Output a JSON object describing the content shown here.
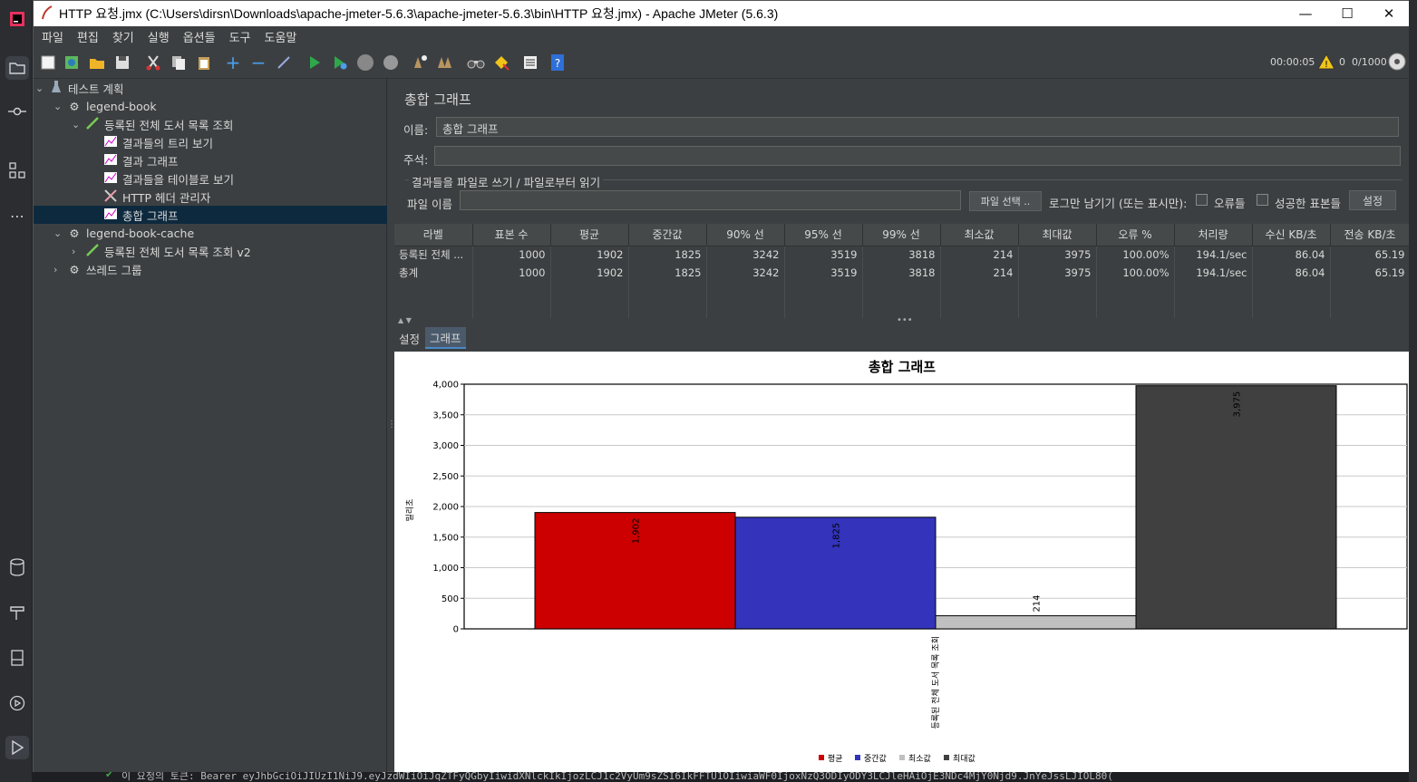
{
  "window": {
    "title": "HTTP 요청.jmx (C:\\Users\\dirsn\\Downloads\\apache-jmeter-5.6.3\\apache-jmeter-5.6.3\\bin\\HTTP 요청.jmx) - Apache JMeter (5.6.3)",
    "minimize": "—",
    "maximize": "☐",
    "close": "✕"
  },
  "menu": [
    "파일",
    "편집",
    "찾기",
    "실행",
    "옵션들",
    "도구",
    "도움말"
  ],
  "status": {
    "elapsed": "00:00:05",
    "warnings": "0",
    "threads": "0/1000"
  },
  "tree": [
    {
      "label": "테스트 계획",
      "icon": "flask-icon"
    },
    {
      "label": "legend-book",
      "icon": "gear-icon"
    },
    {
      "label": "등록된 전체 도서 목록 조회",
      "icon": "pipette-icon"
    },
    {
      "label": "결과들의 트리 보기",
      "icon": "graph-icon"
    },
    {
      "label": "결과 그래프",
      "icon": "graph-icon"
    },
    {
      "label": "결과들을 테이블로 보기",
      "icon": "graph-icon"
    },
    {
      "label": "HTTP 헤더 관리자",
      "icon": "tools-icon"
    },
    {
      "label": "총합 그래프",
      "icon": "graph-icon"
    },
    {
      "label": "legend-book-cache",
      "icon": "gear-icon"
    },
    {
      "label": "등록된 전체 도서 목록 조회 v2",
      "icon": "pipette-icon"
    },
    {
      "label": "쓰레드 그룹",
      "icon": "gear-icon"
    }
  ],
  "panel": {
    "title": "총합 그래프",
    "name_label": "이름:",
    "name_value": "총합 그래프",
    "comment_label": "주석:",
    "comment_value": "",
    "file_section": "결과들을 파일로 쓰기 / 파일로부터 읽기",
    "filename_label": "파일 이름",
    "filename_value": "",
    "browse_button": "파일 선택 ..",
    "log_only_label": "로그만 남기기 (또는 표시만):",
    "errors_label": "오류들",
    "success_label": "성공한 표본들",
    "configure_button": "설정"
  },
  "table": {
    "headers": [
      "라벨",
      "표본 수",
      "평균",
      "중간값",
      "90% 선",
      "95% 선",
      "99% 선",
      "최소값",
      "최대값",
      "오류 %",
      "처리량",
      "수신 KB/초",
      "전송 KB/초"
    ],
    "rows": [
      [
        "등록된 전체 ...",
        "1000",
        "1902",
        "1825",
        "3242",
        "3519",
        "3818",
        "214",
        "3975",
        "100.00%",
        "194.1/sec",
        "86.04",
        "65.19"
      ],
      [
        "총계",
        "1000",
        "1902",
        "1825",
        "3242",
        "3519",
        "3818",
        "214",
        "3975",
        "100.00%",
        "194.1/sec",
        "86.04",
        "65.19"
      ]
    ]
  },
  "tabs": [
    "설정",
    "그래프"
  ],
  "chart_data": {
    "type": "bar",
    "title": "총합 그래프",
    "ylabel": "밀리초",
    "categories": [
      "등록된 전체 도서 목록 조회"
    ],
    "series": [
      {
        "name": "평균",
        "values": [
          1902
        ],
        "label": "1,902",
        "color": "#cc0000"
      },
      {
        "name": "중간값",
        "values": [
          1825
        ],
        "label": "1,825",
        "color": "#3333bb"
      },
      {
        "name": "최소값",
        "values": [
          214
        ],
        "label": "214",
        "color": "#c0c0c0"
      },
      {
        "name": "최대값",
        "values": [
          3975
        ],
        "label": "3,975",
        "color": "#404040"
      }
    ],
    "ylim": [
      0,
      4000
    ],
    "yticks": [
      "0",
      "500",
      "1,000",
      "1,500",
      "2,000",
      "2,500",
      "3,000",
      "3,500",
      "4,000"
    ],
    "grid": true,
    "legend": "bottom"
  },
  "console": "이 요청의 토큰: Bearer eyJhbGciOiJIUzI1NiJ9.eyJzdWIiOiJqZTFyQGbyIiwidXNlckIkIjozLCJ1c2VyUm9sZSI6IkFFTU1OIiwiaWF0IjoxNzQ3ODIyODY3LCJleHAiOjE3NDc4MjY0Njd9.JnYeJssLJIOL80("
}
